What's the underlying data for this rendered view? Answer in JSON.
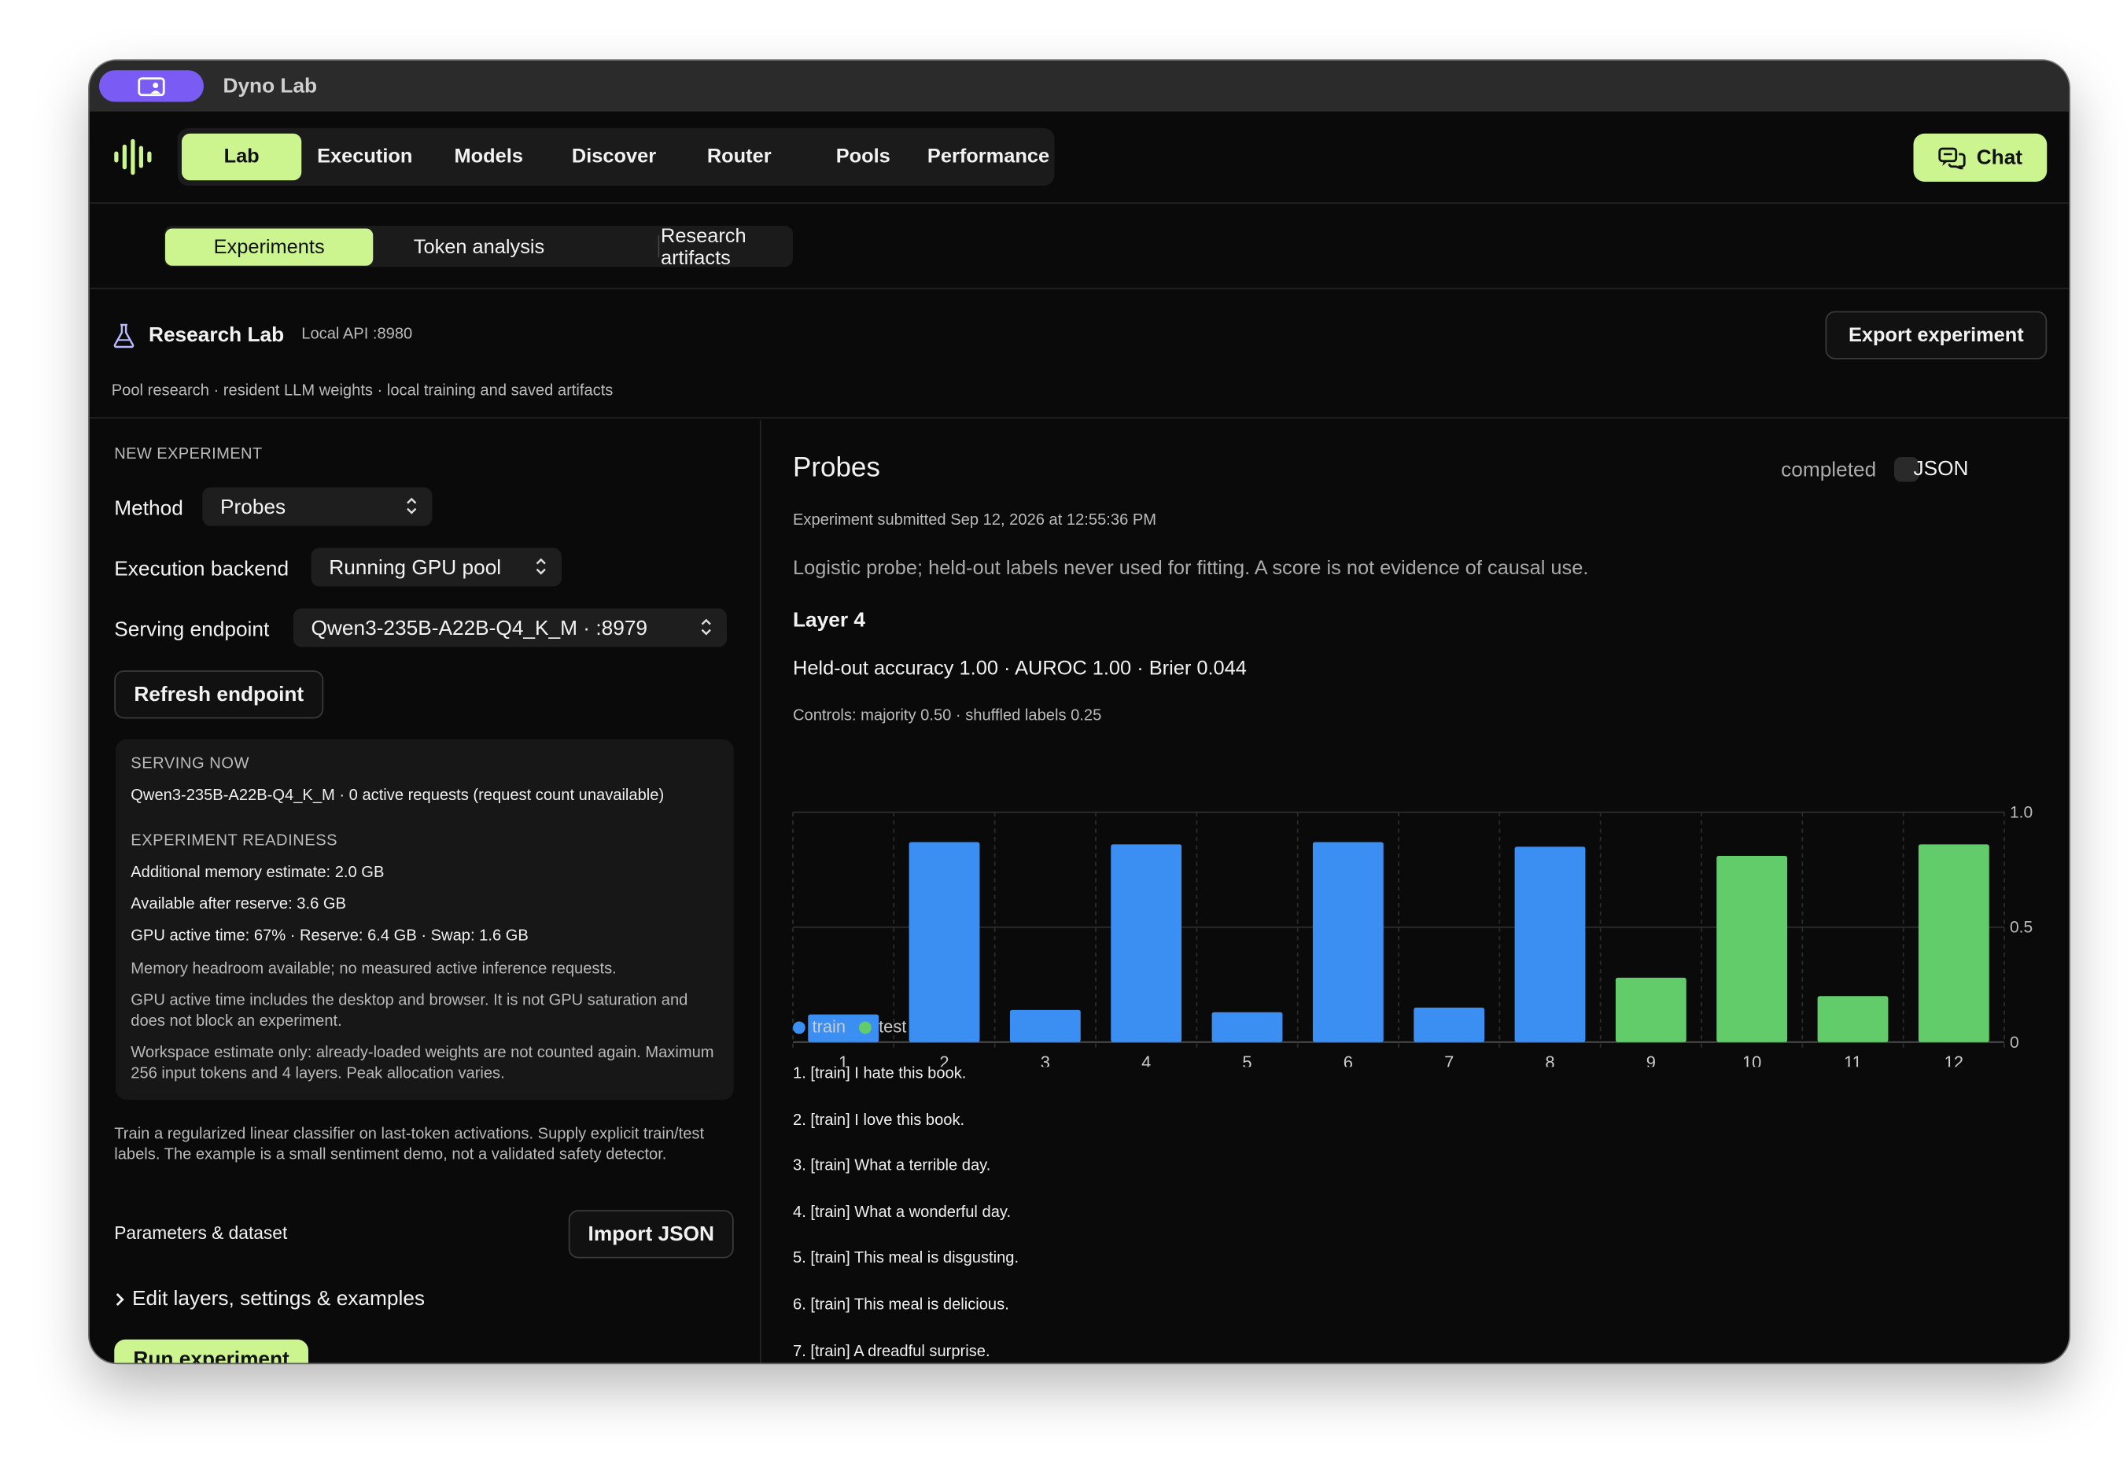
{
  "window": {
    "title": "Dyno Lab"
  },
  "nav": {
    "items": [
      {
        "label": "Lab",
        "active": true
      },
      {
        "label": "Execution",
        "active": false
      },
      {
        "label": "Models",
        "active": false
      },
      {
        "label": "Discover",
        "active": false
      },
      {
        "label": "Router",
        "active": false
      },
      {
        "label": "Pools",
        "active": false
      },
      {
        "label": "Performance",
        "active": false
      }
    ],
    "chat_label": "Chat"
  },
  "subnav": {
    "items": [
      {
        "label": "Experiments",
        "active": true
      },
      {
        "label": "Token analysis",
        "active": false
      },
      {
        "label": "Research artifacts",
        "active": false
      }
    ]
  },
  "lab": {
    "title": "Research Lab",
    "api": "Local API :8980",
    "subtitle": "Pool research · resident LLM weights · local training and saved artifacts",
    "export_label": "Export experiment"
  },
  "new_experiment": {
    "section_label": "NEW EXPERIMENT",
    "method_label": "Method",
    "method_value": "Probes",
    "backend_label": "Execution backend",
    "backend_value": "Running GPU pool",
    "endpoint_label": "Serving endpoint",
    "endpoint_value": "Qwen3-235B-A22B-Q4_K_M · :8979",
    "refresh_label": "Refresh endpoint",
    "serving_now_label": "SERVING NOW",
    "serving_now_value": "Qwen3-235B-A22B-Q4_K_M · 0 active requests (request count unavailable)",
    "readiness_label": "EXPERIMENT READINESS",
    "readiness_lines": [
      "Additional memory estimate: 2.0 GB",
      "Available after reserve: 3.6 GB",
      "GPU active time: 67% · Reserve: 6.4 GB · Swap: 1.6 GB"
    ],
    "notes": [
      "Memory headroom available; no measured active inference requests.",
      "GPU active time includes the desktop and browser. It is not GPU saturation and does not block an experiment.",
      "Workspace estimate only: already-loaded weights are not counted again. Maximum 256 input tokens and 4 layers. Peak allocation varies."
    ],
    "description": "Train a regularized linear classifier on last-token activations. Supply explicit train/test labels. The example is a small sentiment demo, not a validated safety detector.",
    "params_label": "Parameters & dataset",
    "import_label": "Import JSON",
    "edit_label": "Edit layers, settings & examples",
    "run_label": "Run experiment"
  },
  "result": {
    "title": "Probes",
    "status": "completed",
    "json_label": "JSON",
    "submitted": "Experiment submitted Sep 12, 2026 at 12:55:36 PM",
    "description": "Logistic probe; held-out labels never used for fitting. A score is not evidence of causal use.",
    "layer": "Layer 4",
    "metrics": "Held-out accuracy 1.00 · AUROC 1.00 · Brier 0.044",
    "controls": "Controls: majority 0.50 · shuffled labels 0.25",
    "examples": [
      "1. [train] I hate this book.",
      "2. [train] I love this book.",
      "3. [train] What a terrible day.",
      "4. [train] What a wonderful day.",
      "5. [train] This meal is disgusting.",
      "6. [train] This meal is delicious.",
      "7. [train] A dreadful surprise."
    ]
  },
  "chart_data": {
    "type": "bar",
    "categories": [
      "1",
      "2",
      "3",
      "4",
      "5",
      "6",
      "7",
      "8",
      "9",
      "10",
      "11",
      "12"
    ],
    "values": [
      0.12,
      0.87,
      0.14,
      0.86,
      0.13,
      0.87,
      0.15,
      0.85,
      0.28,
      0.81,
      0.2,
      0.86
    ],
    "split": [
      "train",
      "train",
      "train",
      "train",
      "train",
      "train",
      "train",
      "train",
      "test",
      "test",
      "test",
      "test"
    ],
    "ylim": [
      0,
      1.0
    ],
    "yticks": [
      "1.0",
      "0.5",
      "0"
    ],
    "legend": [
      {
        "name": "train",
        "color": "#3b8ef2"
      },
      {
        "name": "test",
        "color": "#62cc6a"
      }
    ],
    "grid": true
  }
}
